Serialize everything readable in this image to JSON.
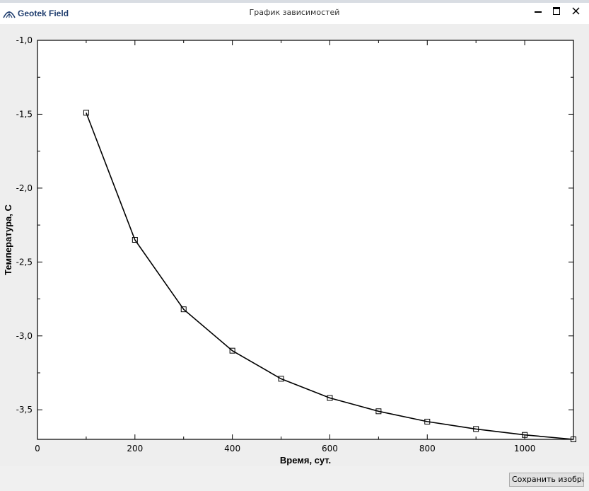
{
  "window": {
    "app_name": "Geotek Field",
    "title": "График зависимостей",
    "icons": {
      "minimize": "minimize-icon",
      "maximize": "maximize-icon",
      "close": "close-icon",
      "logo": "geotek-logo-icon"
    }
  },
  "chart_data": {
    "type": "line",
    "title": "",
    "xlabel": "Время, сут.",
    "ylabel": "Температура, С",
    "xlim": [
      0,
      1100
    ],
    "ylim": [
      -3.7,
      -1.0
    ],
    "x_ticks": [
      0,
      200,
      400,
      600,
      800,
      1000
    ],
    "x_tick_labels": [
      "0",
      "200",
      "400",
      "600",
      "800",
      "1000"
    ],
    "y_ticks": [
      -1.0,
      -1.5,
      -2.0,
      -2.5,
      -3.0,
      -3.5
    ],
    "y_tick_labels": [
      "-1,0",
      "-1,5",
      "-2,0",
      "-2,5",
      "-3,0",
      "-3,5"
    ],
    "grid": false,
    "marker": "square",
    "line_color": "#000000",
    "series": [
      {
        "x": [
          100,
          200,
          300,
          400,
          500,
          600,
          700,
          800,
          900,
          1000,
          1100
        ],
        "values": [
          -1.49,
          -2.35,
          -2.82,
          -3.1,
          -3.29,
          -3.42,
          -3.51,
          -3.58,
          -3.63,
          -3.67,
          -3.7
        ]
      }
    ]
  },
  "footer": {
    "save_label": "Сохранить изображение"
  }
}
